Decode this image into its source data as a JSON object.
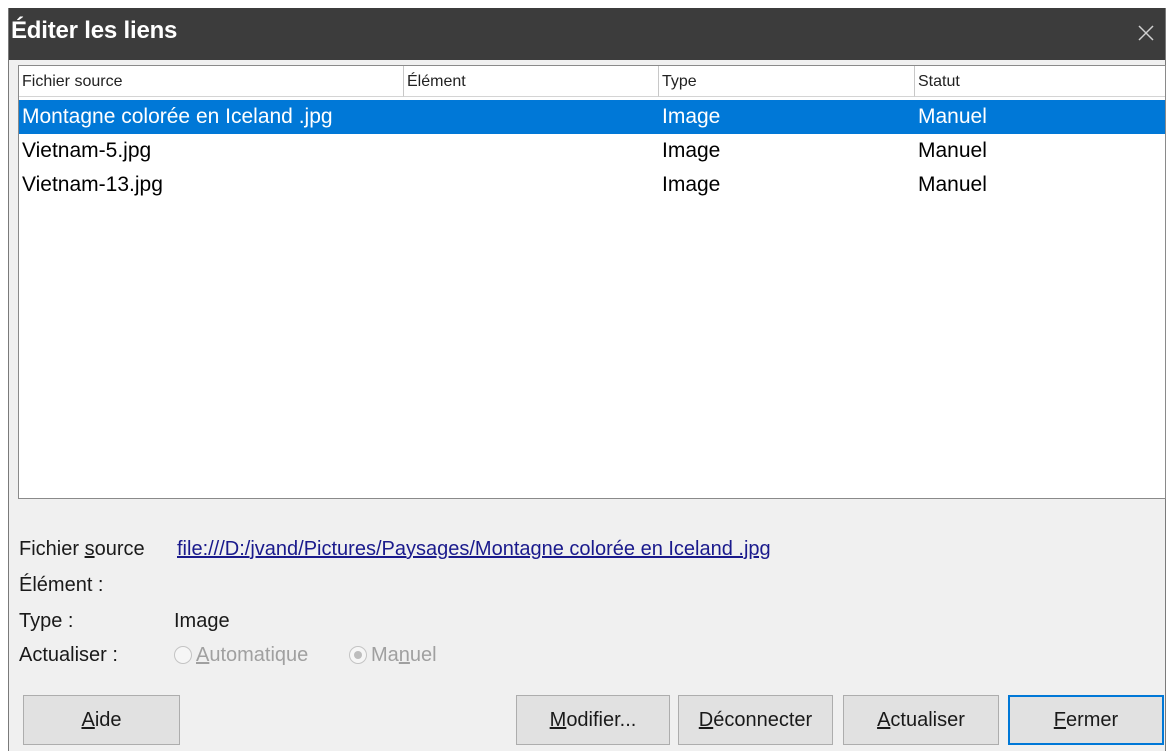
{
  "window": {
    "title": "Éditer les liens"
  },
  "list": {
    "columns": [
      "Fichier source",
      "Élément",
      "Type",
      "Statut"
    ],
    "rows": [
      {
        "source": "Montagne colorée en Iceland .jpg",
        "element": "",
        "type": "Image",
        "status": "Manuel",
        "selected": true
      },
      {
        "source": "Vietnam-5.jpg",
        "element": "",
        "type": "Image",
        "status": "Manuel",
        "selected": false
      },
      {
        "source": "Vietnam-13.jpg",
        "element": "",
        "type": "Image",
        "status": "Manuel",
        "selected": false
      }
    ]
  },
  "details": {
    "source_label_pre": "Fichier ",
    "source_label_mnemonic": "s",
    "source_label_post": "ource",
    "source_value": "file:///D:/jvand/Pictures/Paysages/Montagne colorée en Iceland .jpg",
    "element_label": "Élément :",
    "element_value": "",
    "type_label": "Type :",
    "type_value": "Image",
    "update_label": "Actualiser :",
    "auto_mnemonic": "A",
    "auto_rest": "utomatique",
    "manual_pre": "Ma",
    "manual_mnemonic": "n",
    "manual_post": "uel",
    "update_mode": "Manuel"
  },
  "buttons": {
    "help_mnemonic": "A",
    "help_rest": "ide",
    "modify_mnemonic": "M",
    "modify_rest": "odifier...",
    "disconnect_mnemonic": "D",
    "disconnect_rest": "éconnecter",
    "refresh_mnemonic": "A",
    "refresh_rest": "ctualiser",
    "close_mnemonic": "F",
    "close_rest": "ermer"
  },
  "colors": {
    "titlebar": "#3c3c3c",
    "selection": "#0078d7",
    "dialog_bg": "#f0f0f0",
    "link": "#1a1a8c"
  }
}
